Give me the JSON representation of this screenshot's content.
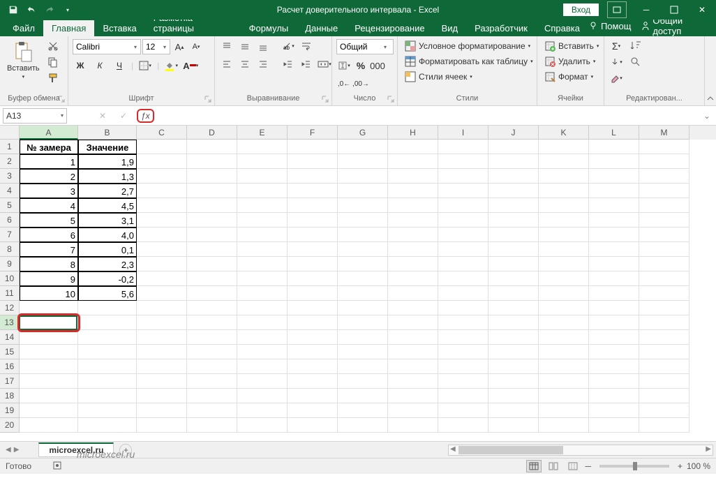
{
  "title": "Расчет доверительного интервала - Excel",
  "login": "Вход",
  "tabs": [
    "Файл",
    "Главная",
    "Вставка",
    "Разметка страницы",
    "Формулы",
    "Данные",
    "Рецензирование",
    "Вид",
    "Разработчик",
    "Справка"
  ],
  "help_hint": "Помощ",
  "share": "Общий доступ",
  "ribbon": {
    "clipboard": {
      "paste": "Вставить",
      "label": "Буфер обмена"
    },
    "font": {
      "name": "Calibri",
      "size": "12",
      "label": "Шрифт",
      "bold": "Ж",
      "italic": "К",
      "underline": "Ч"
    },
    "alignment": {
      "label": "Выравнивание"
    },
    "number": {
      "label": "Число",
      "format": "Общий"
    },
    "styles": {
      "label": "Стили",
      "cf": "Условное форматирование",
      "fat": "Форматировать как таблицу",
      "cs": "Стили ячеек"
    },
    "cells": {
      "label": "Ячейки",
      "insert": "Вставить",
      "delete": "Удалить",
      "format": "Формат"
    },
    "editing": {
      "label": "Редактирован..."
    }
  },
  "name_box": "A13",
  "columns": [
    "A",
    "B",
    "C",
    "D",
    "E",
    "F",
    "G",
    "H",
    "I",
    "J",
    "K",
    "L",
    "M"
  ],
  "row_headers": [
    1,
    2,
    3,
    4,
    5,
    6,
    7,
    8,
    9,
    10,
    11,
    12,
    13,
    14,
    15,
    16,
    17,
    18,
    19,
    20
  ],
  "table": {
    "h1": "№ замера",
    "h2": "Значение",
    "rows": [
      {
        "a": "1",
        "b": "1,9"
      },
      {
        "a": "2",
        "b": "1,3"
      },
      {
        "a": "3",
        "b": "2,7"
      },
      {
        "a": "4",
        "b": "4,5"
      },
      {
        "a": "5",
        "b": "3,1"
      },
      {
        "a": "6",
        "b": "4,0"
      },
      {
        "a": "7",
        "b": "0,1"
      },
      {
        "a": "8",
        "b": "2,3"
      },
      {
        "a": "9",
        "b": "-0,2"
      },
      {
        "a": "10",
        "b": "5,6"
      }
    ]
  },
  "sheet": "microexcel.ru",
  "status": "Готово",
  "zoom": "100 %",
  "watermark": "microexcel.ru"
}
